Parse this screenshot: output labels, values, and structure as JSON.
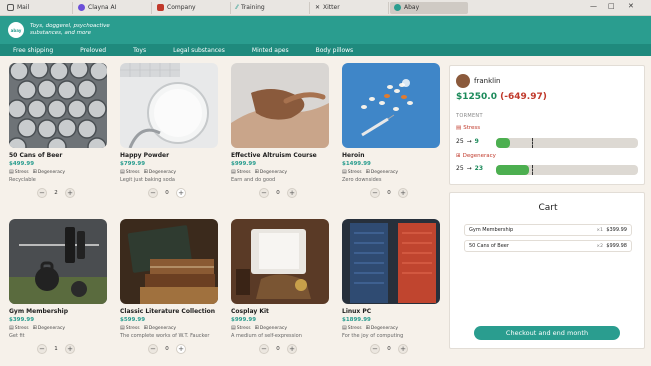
{
  "browser": {
    "tabs": [
      {
        "label": "Mail",
        "color": "#555"
      },
      {
        "label": "Clayna AI",
        "color": "#6b4fd8"
      },
      {
        "label": "Company",
        "color": "#c0392b"
      },
      {
        "label": "Training",
        "color": "#2a9d8f"
      },
      {
        "label": "Xitter",
        "color": "#111"
      },
      {
        "label": "Abay",
        "color": "#2a9d8f"
      }
    ],
    "window_controls": [
      "—",
      "□",
      "✕"
    ]
  },
  "header": {
    "logo_text": "abay",
    "tagline": "Toys, doggerel, psychoactive substances, and more"
  },
  "nav": [
    "Free shipping",
    "Preloved",
    "Toys",
    "Legal substances",
    "Minted apes",
    "Body pillows"
  ],
  "products": [
    {
      "name": "50 Cans of Beer",
      "price": "$499.99",
      "stress": "Stress",
      "degeneracy": "Degeneracy",
      "desc": "Recyclable",
      "qty": "2",
      "img": "beer"
    },
    {
      "name": "Happy Powder",
      "price": "$799.99",
      "stress": "Stress",
      "degeneracy": "Degeneracy",
      "desc": "Legit just baking soda",
      "qty": "0",
      "img": "powder"
    },
    {
      "name": "Effective Altruism Course",
      "price": "$999.99",
      "stress": "Stress",
      "degeneracy": "Degeneracy",
      "desc": "Earn and do good",
      "qty": "0",
      "img": "hands"
    },
    {
      "name": "Heroin",
      "price": "$1499.99",
      "stress": "Stress",
      "degeneracy": "Degeneracy",
      "desc": "Zero downsides",
      "qty": "0",
      "img": "pills"
    },
    {
      "name": "Gym Membership",
      "price": "$399.99",
      "stress": "Stress",
      "degeneracy": "Degeneracy",
      "desc": "Get fit",
      "qty": "1",
      "img": "gym"
    },
    {
      "name": "Classic Literature Collection",
      "price": "$599.99",
      "stress": "Stress",
      "degeneracy": "Degeneracy",
      "desc": "The complete works of W.T. Faucker",
      "qty": "0",
      "img": "books"
    },
    {
      "name": "Cosplay Kit",
      "price": "$999.99",
      "stress": "Stress",
      "degeneracy": "Degeneracy",
      "desc": "A medium of self-expression",
      "qty": "0",
      "img": "cosplay"
    },
    {
      "name": "Linux PC",
      "price": "$1899.99",
      "stress": "Stress",
      "degeneracy": "Degeneracy",
      "desc": "For the joy of computing",
      "qty": "0",
      "img": "pc"
    }
  ],
  "user": {
    "name": "franklin",
    "balance": "$1250.0",
    "delta": "(-649.97)",
    "torment_label": "TORMENT",
    "stress": {
      "label": "Stress",
      "from": "25",
      "to": "9",
      "level_fraction": 0.09,
      "marker_fraction": 0.25
    },
    "degeneracy": {
      "label": "Degeneracy",
      "from": "25",
      "to": "23",
      "level_fraction": 0.23,
      "marker_fraction": 0.25
    }
  },
  "cart": {
    "title": "Cart",
    "items": [
      {
        "name": "Gym Membership",
        "qty": "×1",
        "price": "$399.99"
      },
      {
        "name": "50 Cans of Beer",
        "qty": "×2",
        "price": "$999.98"
      }
    ],
    "checkout_label": "Checkout and end month"
  },
  "colors": {
    "accent": "#2a9d8f",
    "balance": "#1b8a5a",
    "negative": "#c0392b"
  }
}
